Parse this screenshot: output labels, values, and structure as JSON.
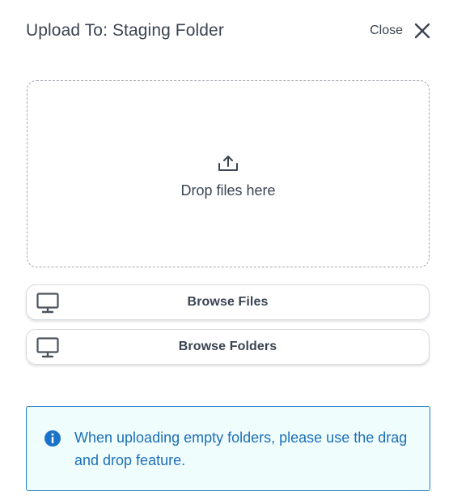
{
  "dialog": {
    "title": "Upload To: Staging Folder",
    "close_label": "Close",
    "close_icon": "x-icon"
  },
  "dropzone": {
    "icon": "upload-icon",
    "label": "Drop files here"
  },
  "buttons": {
    "browse_files": {
      "label": "Browse Files",
      "icon": "monitor-icon"
    },
    "browse_folders": {
      "label": "Browse Folders",
      "icon": "monitor-icon"
    }
  },
  "notice": {
    "icon": "info-icon",
    "text": "When uploading empty folders, please use the drag and drop feature."
  },
  "colors": {
    "text": "#3b4451",
    "info_text": "#1c6fb8",
    "info_border": "#1f7fc4",
    "info_background": "#f0fdfd",
    "info_icon": "#1a73c8"
  }
}
